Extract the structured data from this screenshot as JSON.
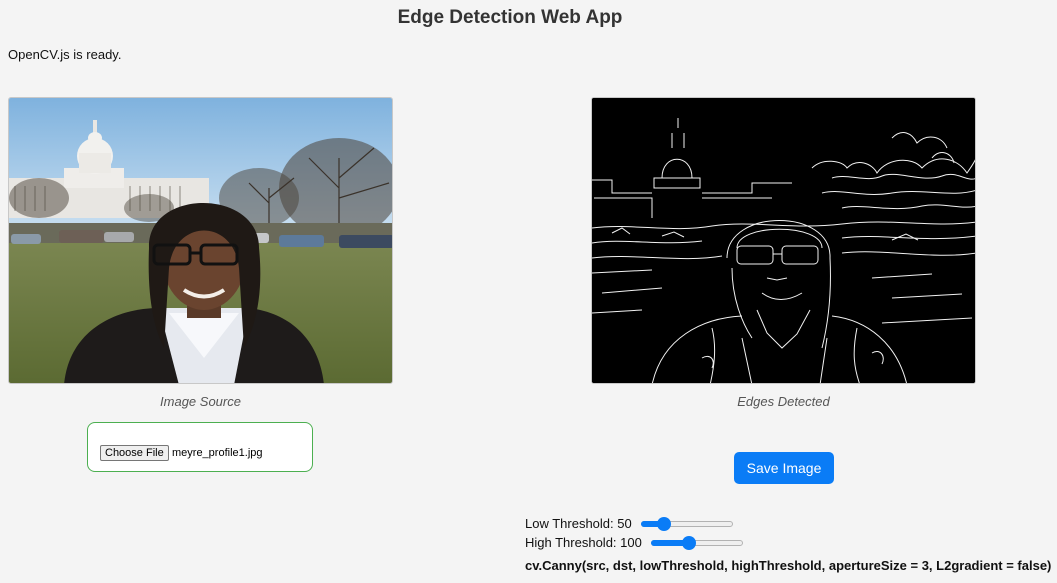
{
  "app": {
    "title": "Edge Detection Web App",
    "status": "OpenCV.js is ready."
  },
  "source": {
    "caption": "Image Source"
  },
  "output": {
    "caption": "Edges Detected"
  },
  "file_input": {
    "button_label": "Choose File",
    "file_name": "meyre_profile1.jpg"
  },
  "save_button": {
    "label": "Save Image"
  },
  "sliders": {
    "low": {
      "label": "Low Threshold: 50",
      "value": 50,
      "min": 0,
      "max": 255
    },
    "high": {
      "label": "High Threshold: 100",
      "value": 100,
      "min": 0,
      "max": 255
    }
  },
  "code": {
    "line": "cv.Canny(src, dst, lowThreshold, highThreshold, apertureSize = 3, L2gradient = false)"
  },
  "colors": {
    "accent": "#0a7cf6",
    "file_box_border": "#4caf50",
    "output_bg": "#000000"
  }
}
